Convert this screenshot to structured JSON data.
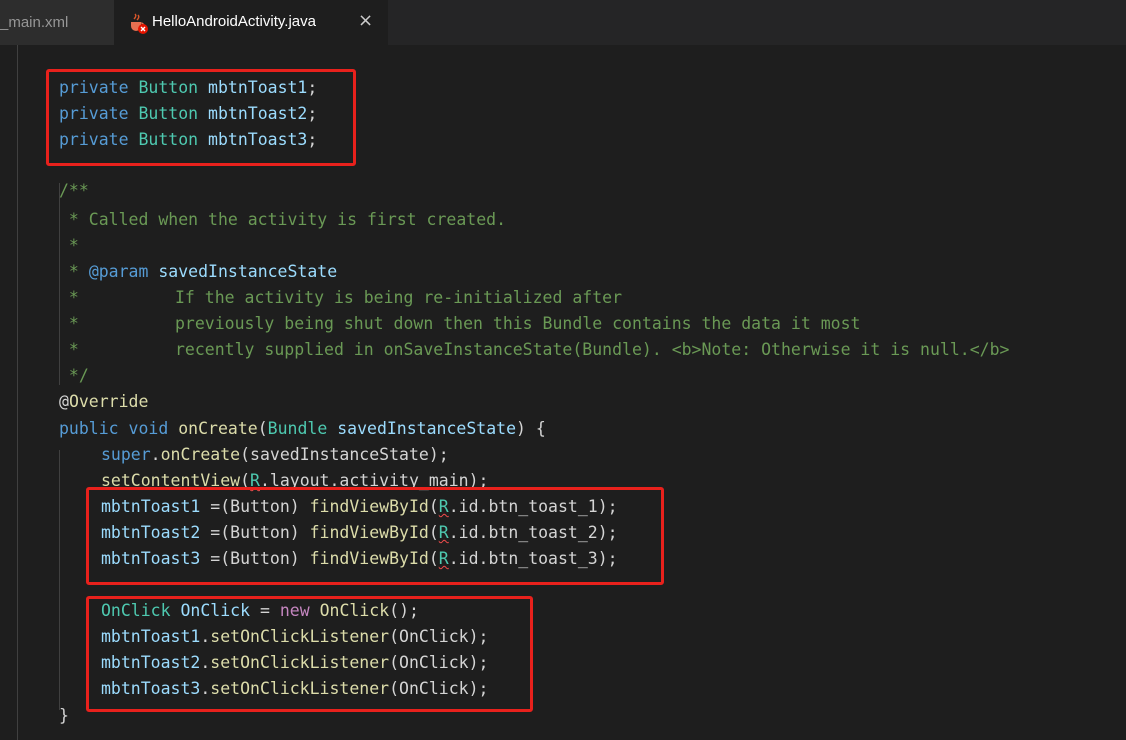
{
  "tabs": [
    {
      "label": "_main.xml",
      "active": false
    },
    {
      "label": "HelloAndroidActivity.java",
      "active": true,
      "close": "×"
    }
  ],
  "code": {
    "top_fragment": "",
    "fields": [
      {
        "mod": "private",
        "type": "Button",
        "name": "mbtnToast1",
        "end": ";"
      },
      {
        "mod": "private",
        "type": "Button",
        "name": "mbtnToast2",
        "end": ";"
      },
      {
        "mod": "private",
        "type": "Button",
        "name": "mbtnToast3",
        "end": ";"
      }
    ],
    "doc": {
      "open": "/**",
      "l1": " * Called when the activity is first created.",
      "l2": " *",
      "l3_star": " * ",
      "l3_tag": "@param",
      "l3_name": " savedInstanceState",
      "l4_star": " *",
      "l4_text": "If the activity is being re-initialized after",
      "l5_star": " *",
      "l5_text": "previously being shut down then this Bundle contains the data it most",
      "l6_star": " *",
      "l6_text": "recently supplied in onSaveInstanceState(Bundle). <b>Note: Otherwise it is null.</b>",
      "close": " */"
    },
    "annotation_at": "@",
    "annotation": "Override",
    "sig": {
      "pub": "public",
      "void": "void",
      "fn": "onCreate",
      "lp": "(",
      "type": "Bundle",
      "param": "savedInstanceState",
      "rest": ") {"
    },
    "super_line": {
      "kw": "super",
      "dot": ".",
      "fn": "onCreate",
      "rest": "(savedInstanceState);"
    },
    "set_line": {
      "fn": "setContentView",
      "lp": "(",
      "r": "R",
      "rest": ".layout.activity_main);"
    },
    "finds": [
      {
        "var": "mbtnToast1",
        "eq": " =(Button) ",
        "fn": "findViewById",
        "lp": "(",
        "r": "R",
        "rest": ".id.btn_toast_1);"
      },
      {
        "var": "mbtnToast2",
        "eq": " =(Button) ",
        "fn": "findViewById",
        "lp": "(",
        "r": "R",
        "rest": ".id.btn_toast_2);"
      },
      {
        "var": "mbtnToast3",
        "eq": " =(Button) ",
        "fn": "findViewById",
        "lp": "(",
        "r": "R",
        "rest": ".id.btn_toast_3);"
      }
    ],
    "onclick_decl": {
      "type": "OnClick",
      "var": " OnClick",
      "eq": " = ",
      "new": "new",
      "ctor": " OnClick",
      "rest": "();"
    },
    "listeners": [
      {
        "var": "mbtnToast1",
        "dot": ".",
        "fn": "setOnClickListener",
        "rest": "(OnClick);"
      },
      {
        "var": "mbtnToast2",
        "dot": ".",
        "fn": "setOnClickListener",
        "rest": "(OnClick);"
      },
      {
        "var": "mbtnToast3",
        "dot": ".",
        "fn": "setOnClickListener",
        "rest": "(OnClick);"
      }
    ],
    "close_brace": "}"
  },
  "colors": {
    "annotation_box": "#e8211c",
    "background": "#1e1e1e"
  }
}
